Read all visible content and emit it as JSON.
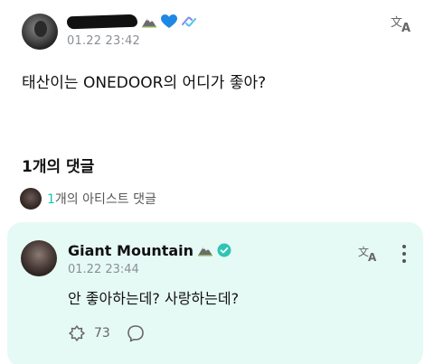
{
  "post": {
    "timestamp": "01.22 23:42",
    "body": "태산이는 ONEDOOR의 어디가 좋아?"
  },
  "comments_section": {
    "title": "1개의 댓글",
    "artist_count": "1",
    "artist_label_suffix": "개의 아티스트 댓글"
  },
  "comment": {
    "author": "Giant Mountain",
    "timestamp": "01.22 23:44",
    "text": "안 좋아하는데? 사랑하는데?",
    "like_count": "73"
  },
  "colors": {
    "accent": "#19c3b0",
    "card_bg": "#e6faf5",
    "verified": "#2ec4b6",
    "heart": "#1e88e5"
  },
  "icons": [
    "translate-icon",
    "mountain-icon",
    "blue-heart-icon",
    "loop-icon",
    "verified-icon",
    "more-vertical-icon",
    "like-icon",
    "reply-icon"
  ]
}
